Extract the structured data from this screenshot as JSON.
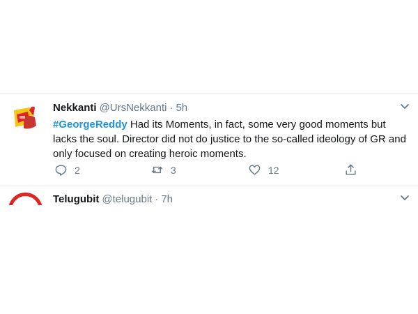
{
  "tweets": [
    {
      "display_name": "Nekkanti",
      "handle": "@UrsNekkanti",
      "separator": "·",
      "time": "5h",
      "hashtag": "#GeorgeReddy",
      "text_line1": " Had its Moments, in fact, some very good moments but",
      "text_line2": "lacks the soul. Director did not do justice to the so-called ideology of GR and",
      "text_line3": "only focused on creating heroic moments.",
      "replies": "2",
      "retweets": "3",
      "likes": "12",
      "avatar_icon": "thumbs-up-hand-avatar"
    },
    {
      "display_name": "Telugubit",
      "handle": "@telugubit",
      "separator": "·",
      "time": "7h",
      "avatar_icon": "red-ring-logo-avatar"
    }
  ],
  "colors": {
    "link": "#1b95e0",
    "muted": "#657786",
    "text": "#14171a",
    "divider": "#e6ecf0",
    "avatar_red": "#e02424",
    "avatar_yellow": "#f5c518"
  }
}
